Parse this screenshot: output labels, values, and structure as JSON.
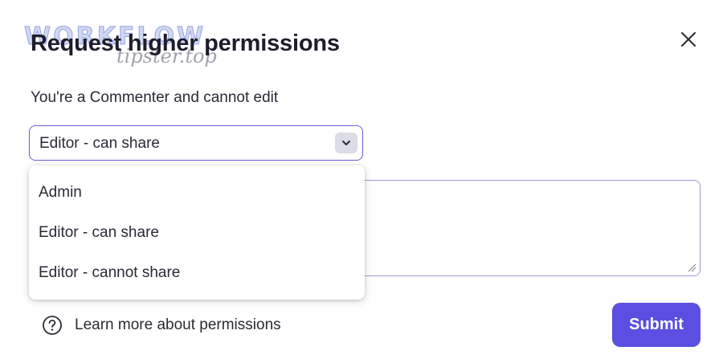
{
  "watermark": {
    "word": "WORKFLOW",
    "site": "tipster.top"
  },
  "dialog": {
    "title": "Request higher permissions",
    "subtitle": "You're a Commenter and cannot edit",
    "close_icon": "close-icon",
    "role_select": {
      "value": "Editor - can share",
      "chevron_icon": "chevron-down-icon",
      "options": [
        "Admin",
        "Editor - can share",
        "Editor - cannot share"
      ]
    },
    "message": {
      "value": ""
    },
    "help": {
      "icon": "question-circle-icon",
      "label": "Learn more about permissions"
    },
    "submit_label": "Submit"
  },
  "colors": {
    "accent": "#5a4fe0",
    "select_border": "#6a5fd4",
    "text": "#2a2a36"
  }
}
